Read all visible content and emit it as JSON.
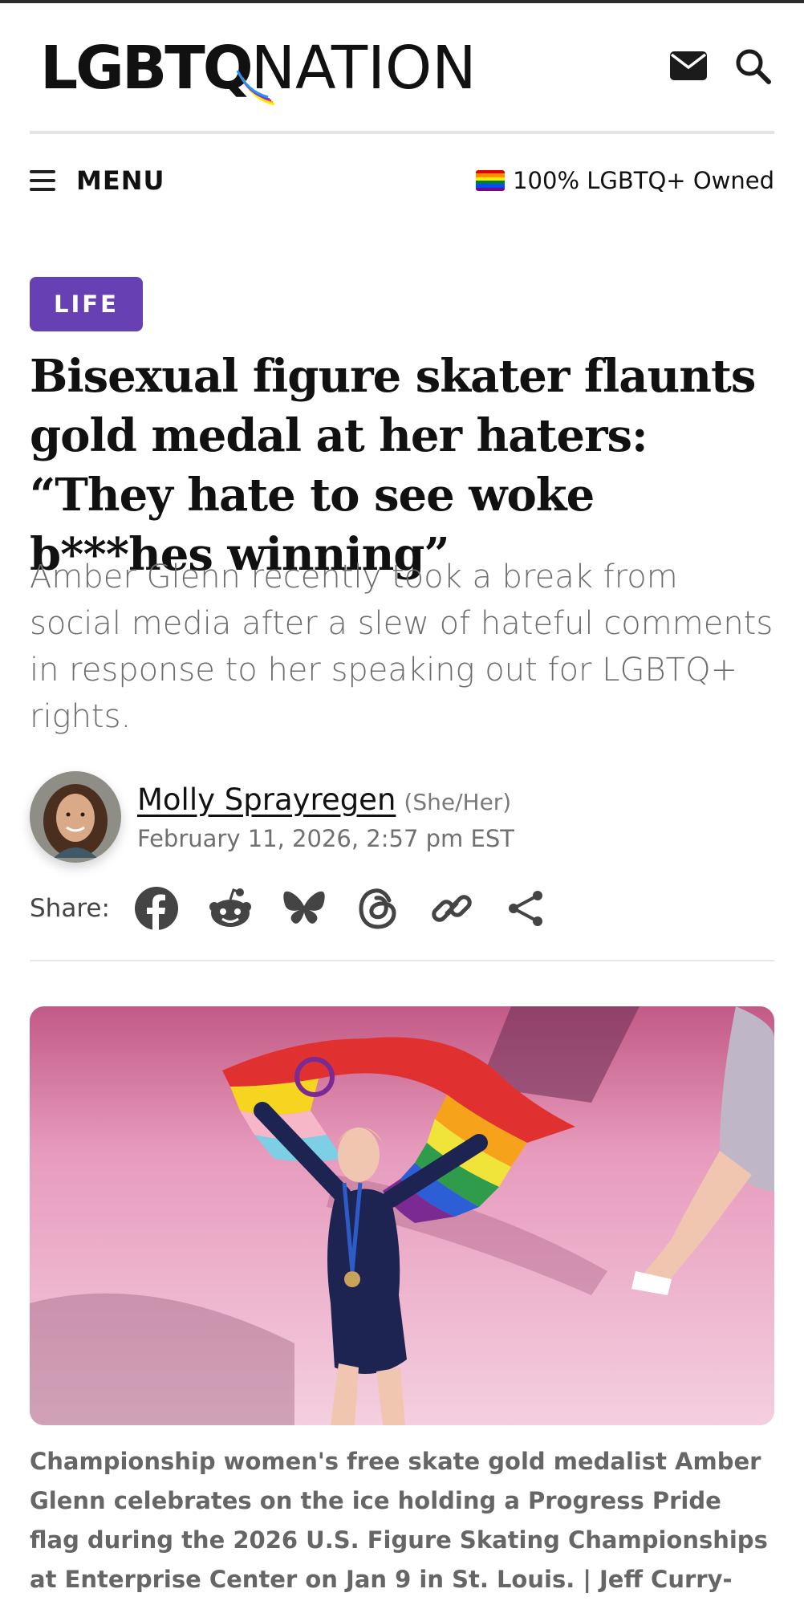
{
  "header": {
    "logo_text_bold": "LGBTQ",
    "logo_text_light": "NATION",
    "icons": [
      "mail-icon",
      "search-icon"
    ]
  },
  "nav": {
    "menu_label": "MENU",
    "owned_label": "100% LGBTQ+ Owned"
  },
  "article": {
    "category": "LIFE",
    "headline": "Bisexual figure skater flaunts gold medal at her haters: “They hate to see woke b***hes winning”",
    "dek": "Amber Glenn recently took a break from social media after a slew of hateful comments in response to her speaking out for LGBTQ+ rights.",
    "author": {
      "name": "Molly Sprayregen",
      "pronouns": "(She/Her)",
      "date": "February 11, 2026, 2:57 pm EST"
    },
    "share": {
      "label": "Share:",
      "icons": [
        "facebook-icon",
        "reddit-icon",
        "bluesky-icon",
        "threads-icon",
        "copy-link-icon",
        "share-icon"
      ]
    },
    "image_caption": "Championship women's free skate gold medalist Amber Glenn celebrates on the ice holding a Progress Pride flag during the 2026 U.S. Figure Skating Championships at Enterprise Center on Jan 9 in St. Louis. | Jeff Curry-Imagn Images"
  },
  "colors": {
    "category_bg": "#6741b4",
    "dek_text": "#6d6d6d",
    "caption_text": "#666666"
  }
}
